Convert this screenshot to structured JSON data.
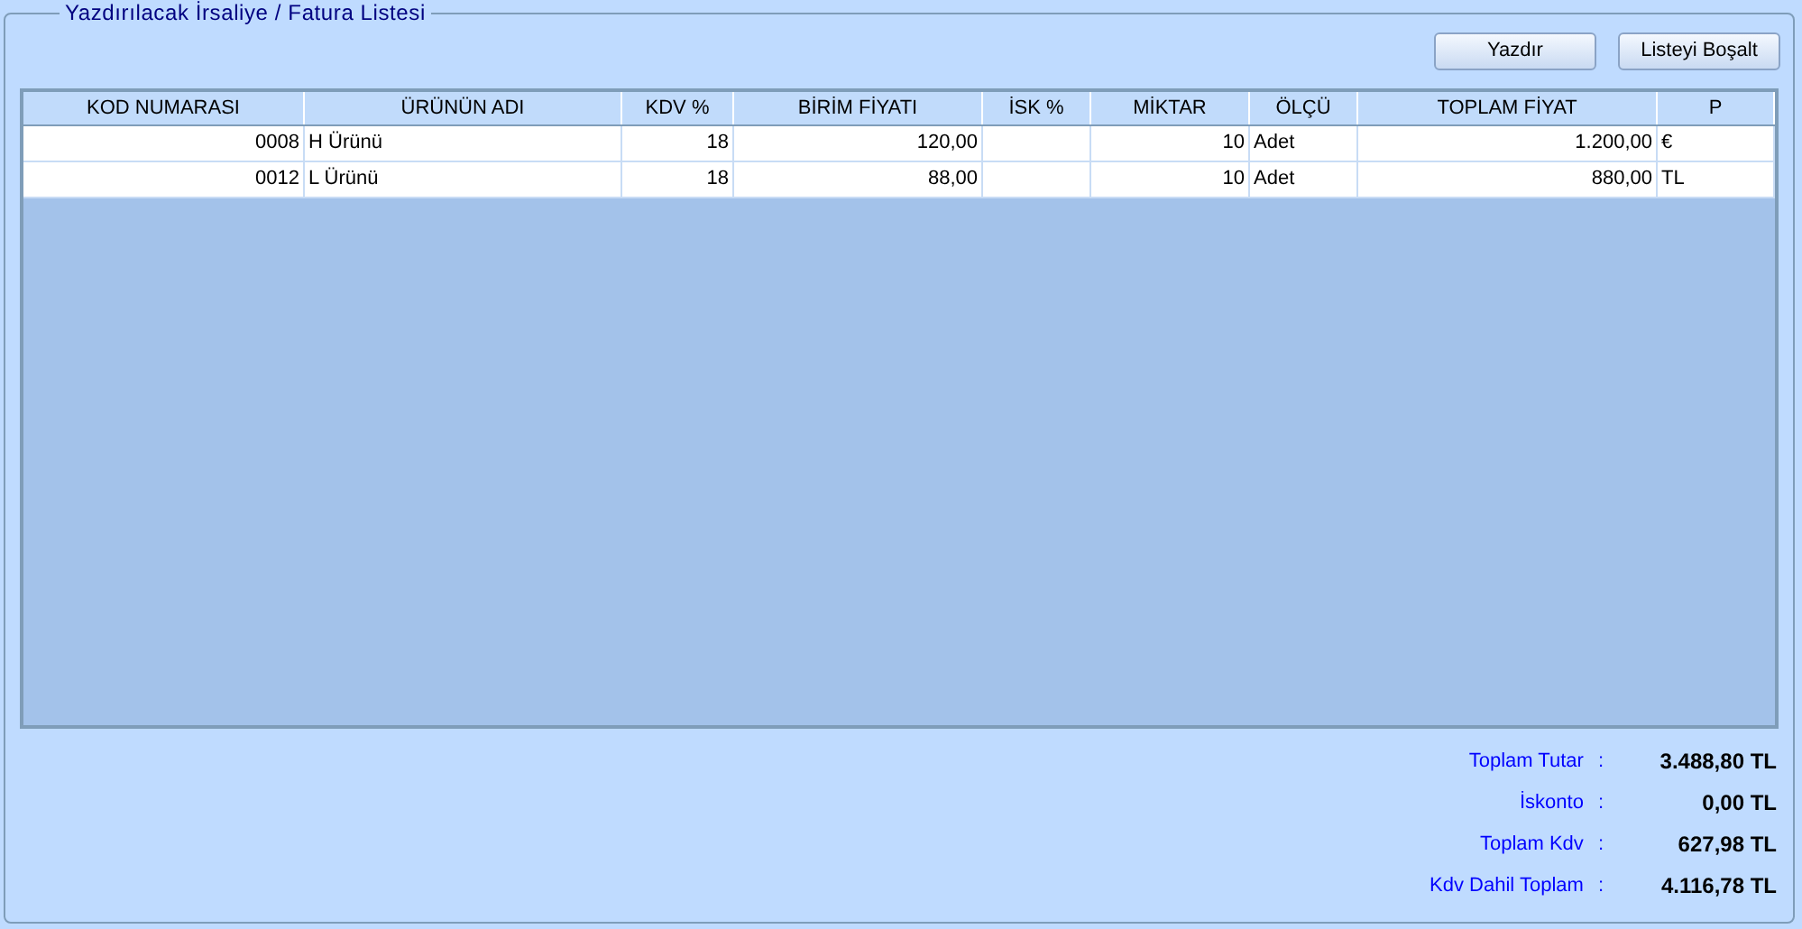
{
  "group_title": "Yazdırılacak İrsaliye / Fatura Listesi",
  "buttons": [
    "Yazdır",
    "Listeyi Boşalt"
  ],
  "table": {
    "columns": [
      "KOD NUMARASI",
      "ÜRÜNÜN ADI",
      "KDV %",
      "BİRİM FİYATI",
      "İSK %",
      "MİKTAR",
      "ÖLÇÜ",
      "TOPLAM FİYAT",
      "P"
    ],
    "rows": [
      [
        "0008",
        "H Ürünü",
        "18",
        "120,00",
        "",
        "10",
        "Adet",
        "1.200,00",
        "€"
      ],
      [
        "0012",
        "L Ürünü",
        "18",
        "88,00",
        "",
        "10",
        "Adet",
        "880,00",
        "TL"
      ]
    ]
  },
  "totals": [
    {
      "label": "Toplam Tutar",
      "value": "3.488,80 TL"
    },
    {
      "label": "İskonto",
      "value": "0,00 TL"
    },
    {
      "label": "Toplam Kdv",
      "value": "627,98 TL"
    },
    {
      "label": "Kdv Dahil Toplam",
      "value": "4.116,78 TL"
    }
  ],
  "colon": ":"
}
